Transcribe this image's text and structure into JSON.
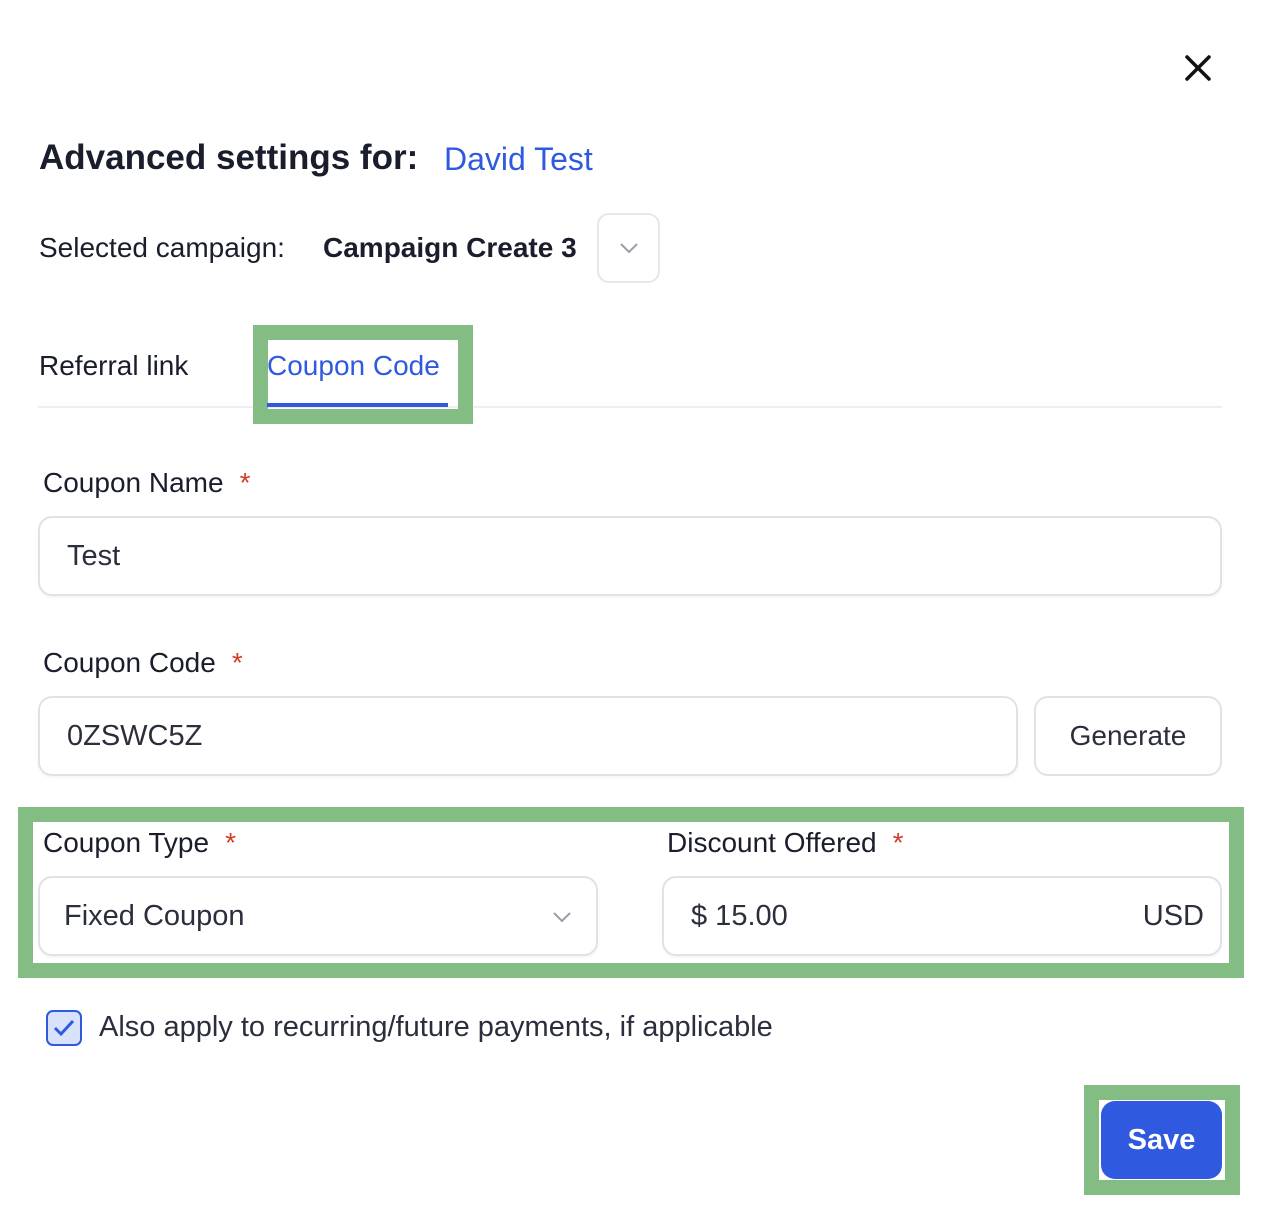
{
  "dialog": {
    "title": "Advanced settings for:",
    "user_name": "David Test",
    "close_icon": "close-icon"
  },
  "campaign": {
    "label": "Selected campaign:",
    "value": "Campaign Create 3"
  },
  "tabs": [
    {
      "label": "Referral link",
      "active": false
    },
    {
      "label": "Coupon Code",
      "active": true
    }
  ],
  "form": {
    "coupon_name": {
      "label": "Coupon Name",
      "required": "*",
      "value": "Test"
    },
    "coupon_code": {
      "label": "Coupon Code",
      "required": "*",
      "value": "0ZSWC5Z",
      "generate_label": "Generate"
    },
    "coupon_type": {
      "label": "Coupon Type",
      "required": "*",
      "value": "Fixed Coupon"
    },
    "discount": {
      "label": "Discount Offered",
      "required": "*",
      "value": "$ 15.00",
      "currency": "USD"
    },
    "recurring": {
      "label": "Also apply to recurring/future payments, if applicable",
      "checked": true
    },
    "save_label": "Save"
  },
  "colors": {
    "accent": "#2f5ae0",
    "required": "#d43a2a",
    "highlight": "#83bd83"
  }
}
